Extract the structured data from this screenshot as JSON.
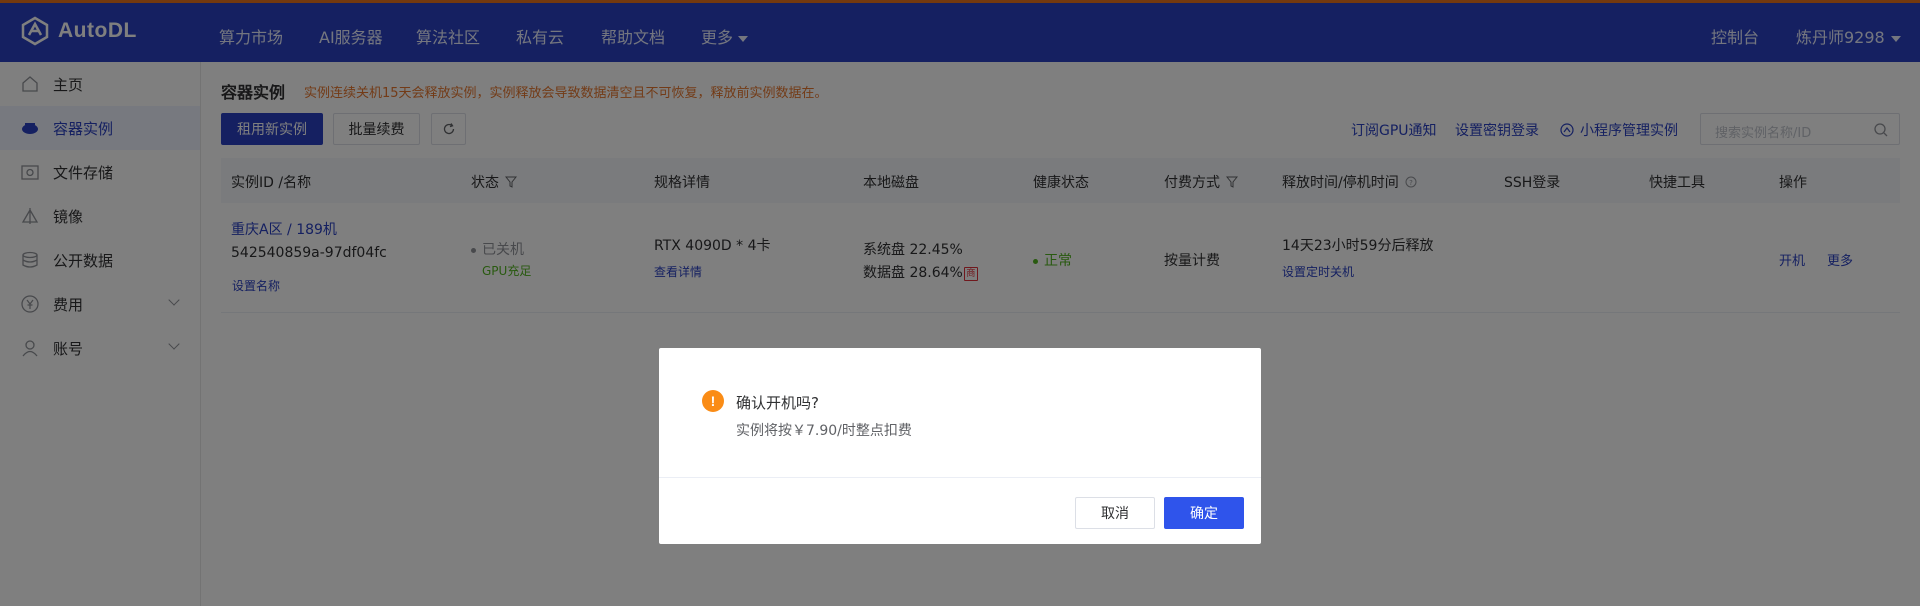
{
  "brand": {
    "name": "AutoDL"
  },
  "nav": {
    "items": [
      "算力市场",
      "AI服务器",
      "算法社区",
      "私有云",
      "帮助文档",
      "更多"
    ],
    "console": "控制台",
    "user": "炼丹师9298"
  },
  "sidebar": {
    "items": [
      {
        "label": "主页",
        "icon": "home-icon"
      },
      {
        "label": "容器实例",
        "icon": "container-icon"
      },
      {
        "label": "文件存储",
        "icon": "storage-icon"
      },
      {
        "label": "镜像",
        "icon": "image-icon"
      },
      {
        "label": "公开数据",
        "icon": "database-icon"
      },
      {
        "label": "费用",
        "icon": "yen-icon"
      },
      {
        "label": "账号",
        "icon": "user-icon"
      }
    ]
  },
  "main": {
    "title": "容器实例",
    "warning": "实例连续关机15天会释放实例，实例释放会导致数据清空且不可恢复，释放前实例数据在。",
    "toolbar": {
      "rent": "租用新实例",
      "batch_renew": "批量续费",
      "gpu_notify": "订阅GPU通知",
      "key_login": "设置密钥登录",
      "mini_program": "小程序管理实例",
      "search_placeholder": "搜索实例名称/ID"
    },
    "table": {
      "headers": [
        "实例ID /名称",
        "状态",
        "规格详情",
        "本地磁盘",
        "健康状态",
        "付费方式",
        "释放时间/停机时间",
        "SSH登录",
        "快捷工具",
        "操作"
      ],
      "row": {
        "name": "重庆A区 / 189机",
        "id": "542540859a-97df04fc",
        "set_name": "设置名称",
        "status": "已关机",
        "gpu": "GPU充足",
        "spec": "RTX 4090D * 4卡",
        "spec_link": "查看详情",
        "disk_sys": "系统盘 22.45%",
        "disk_data": "数据盘 28.64%",
        "disk_tag": "商",
        "health": "正常",
        "billing": "按量计费",
        "release": "14天23小时59分后释放",
        "release_link": "设置定时关机",
        "op_start": "开机",
        "op_more": "更多"
      }
    }
  },
  "dialog": {
    "title": "确认开机吗?",
    "body": "实例将按￥7.90/时整点扣费",
    "cancel": "取消",
    "ok": "确定"
  },
  "colors": {
    "brand": "#2a41c2",
    "warning": "#e6772e",
    "confirm": "#2f54eb",
    "success": "#52b421",
    "dialog_icon": "#fa8c16"
  }
}
